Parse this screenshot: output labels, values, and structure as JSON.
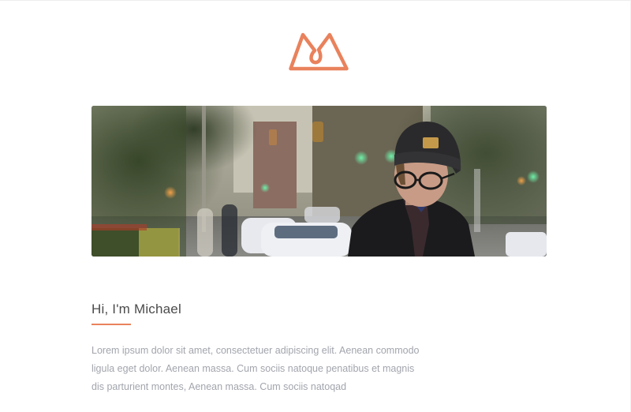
{
  "brand": {
    "logo_icon": "m-monogram-logo-icon",
    "accent_color": "#E9825C"
  },
  "hero": {
    "image": "portrait-photo-man-in-beanie-city-street"
  },
  "about": {
    "heading": "Hi, I'm Michael",
    "paragraph_lines": [
      "Lorem ipsum dolor sit amet, consectetuer adipiscing elit. Aenean commodo",
      "ligula eget dolor. Aenean massa. Cum sociis natoque penatibus et magnis",
      "dis parturient montes, Aenean massa. Cum sociis natoqad"
    ],
    "text_color": "#A2A5AD",
    "heading_color": "#4B4B4B"
  }
}
